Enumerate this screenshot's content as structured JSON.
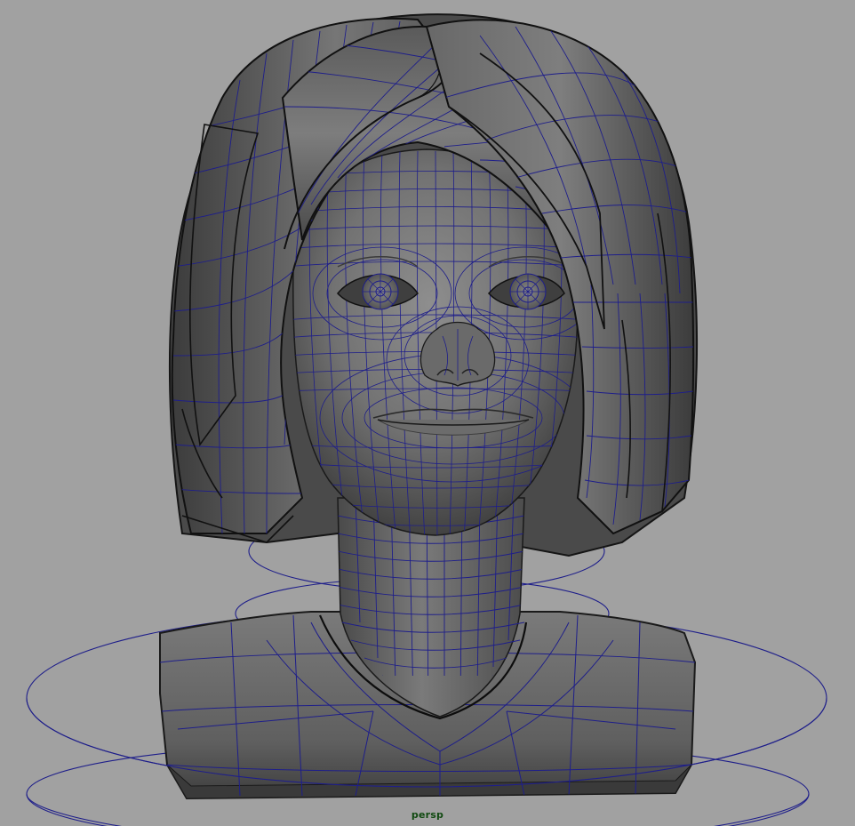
{
  "viewport": {
    "camera_label": "persp",
    "background_color": "#a1a1a1",
    "wire_color": "#1e1e8a",
    "shade_dark": "#3d3d3d",
    "shade_mid": "#6f6f6f",
    "shade_light": "#8d8d8d"
  },
  "scene": {
    "object": "character-head-bust",
    "display_mode": "wireframe-on-shaded",
    "control_curves": 5
  }
}
